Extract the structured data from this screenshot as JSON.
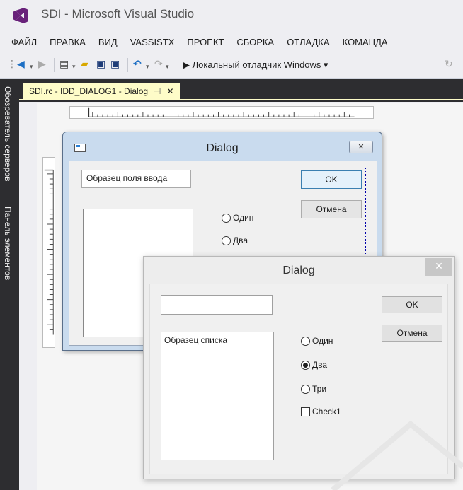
{
  "window": {
    "title": "SDI - Microsoft Visual Studio"
  },
  "menu": [
    "ФАЙЛ",
    "ПРАВКА",
    "ВИД",
    "VASSISTX",
    "ПРОЕКТ",
    "СБОРКА",
    "ОТЛАДКА",
    "КОМАНДА"
  ],
  "toolbar": {
    "debugger_label": "▶ Локальный отладчик Windows ▾"
  },
  "side_tabs": {
    "server_explorer": "Обозреватель серверов",
    "toolbox": "Панель элементов"
  },
  "document_tab": {
    "label": "SDI.rc - IDD_DIALOG1 - Dialog",
    "pin": "⊣",
    "close": "✕"
  },
  "design_dialog": {
    "title": "Dialog",
    "close": "✕",
    "edit_text": "Образец поля ввода",
    "ok": "OK",
    "cancel": "Отмена",
    "radios": [
      "Один",
      "Два"
    ]
  },
  "runtime_dialog": {
    "title": "Dialog",
    "close": "✕",
    "edit_value": "",
    "list_item": "Образец списка",
    "ok": "OK",
    "cancel": "Отмена",
    "radios": [
      "Один",
      "Два",
      "Три"
    ],
    "selected_radio": "Два",
    "checkbox": "Check1",
    "checkbox_checked": false
  },
  "colors": {
    "vs_purple": "#68217a",
    "dark_chrome": "#2d2d30",
    "tab_yellow": "#fefcc8",
    "play_green": "#1e8c3a"
  },
  "icons": [
    "vs-logo-icon",
    "back-icon",
    "forward-icon",
    "new-project-icon",
    "open-icon",
    "save-icon",
    "save-all-icon",
    "undo-icon",
    "redo-icon",
    "play-icon",
    "dialog-icon"
  ]
}
